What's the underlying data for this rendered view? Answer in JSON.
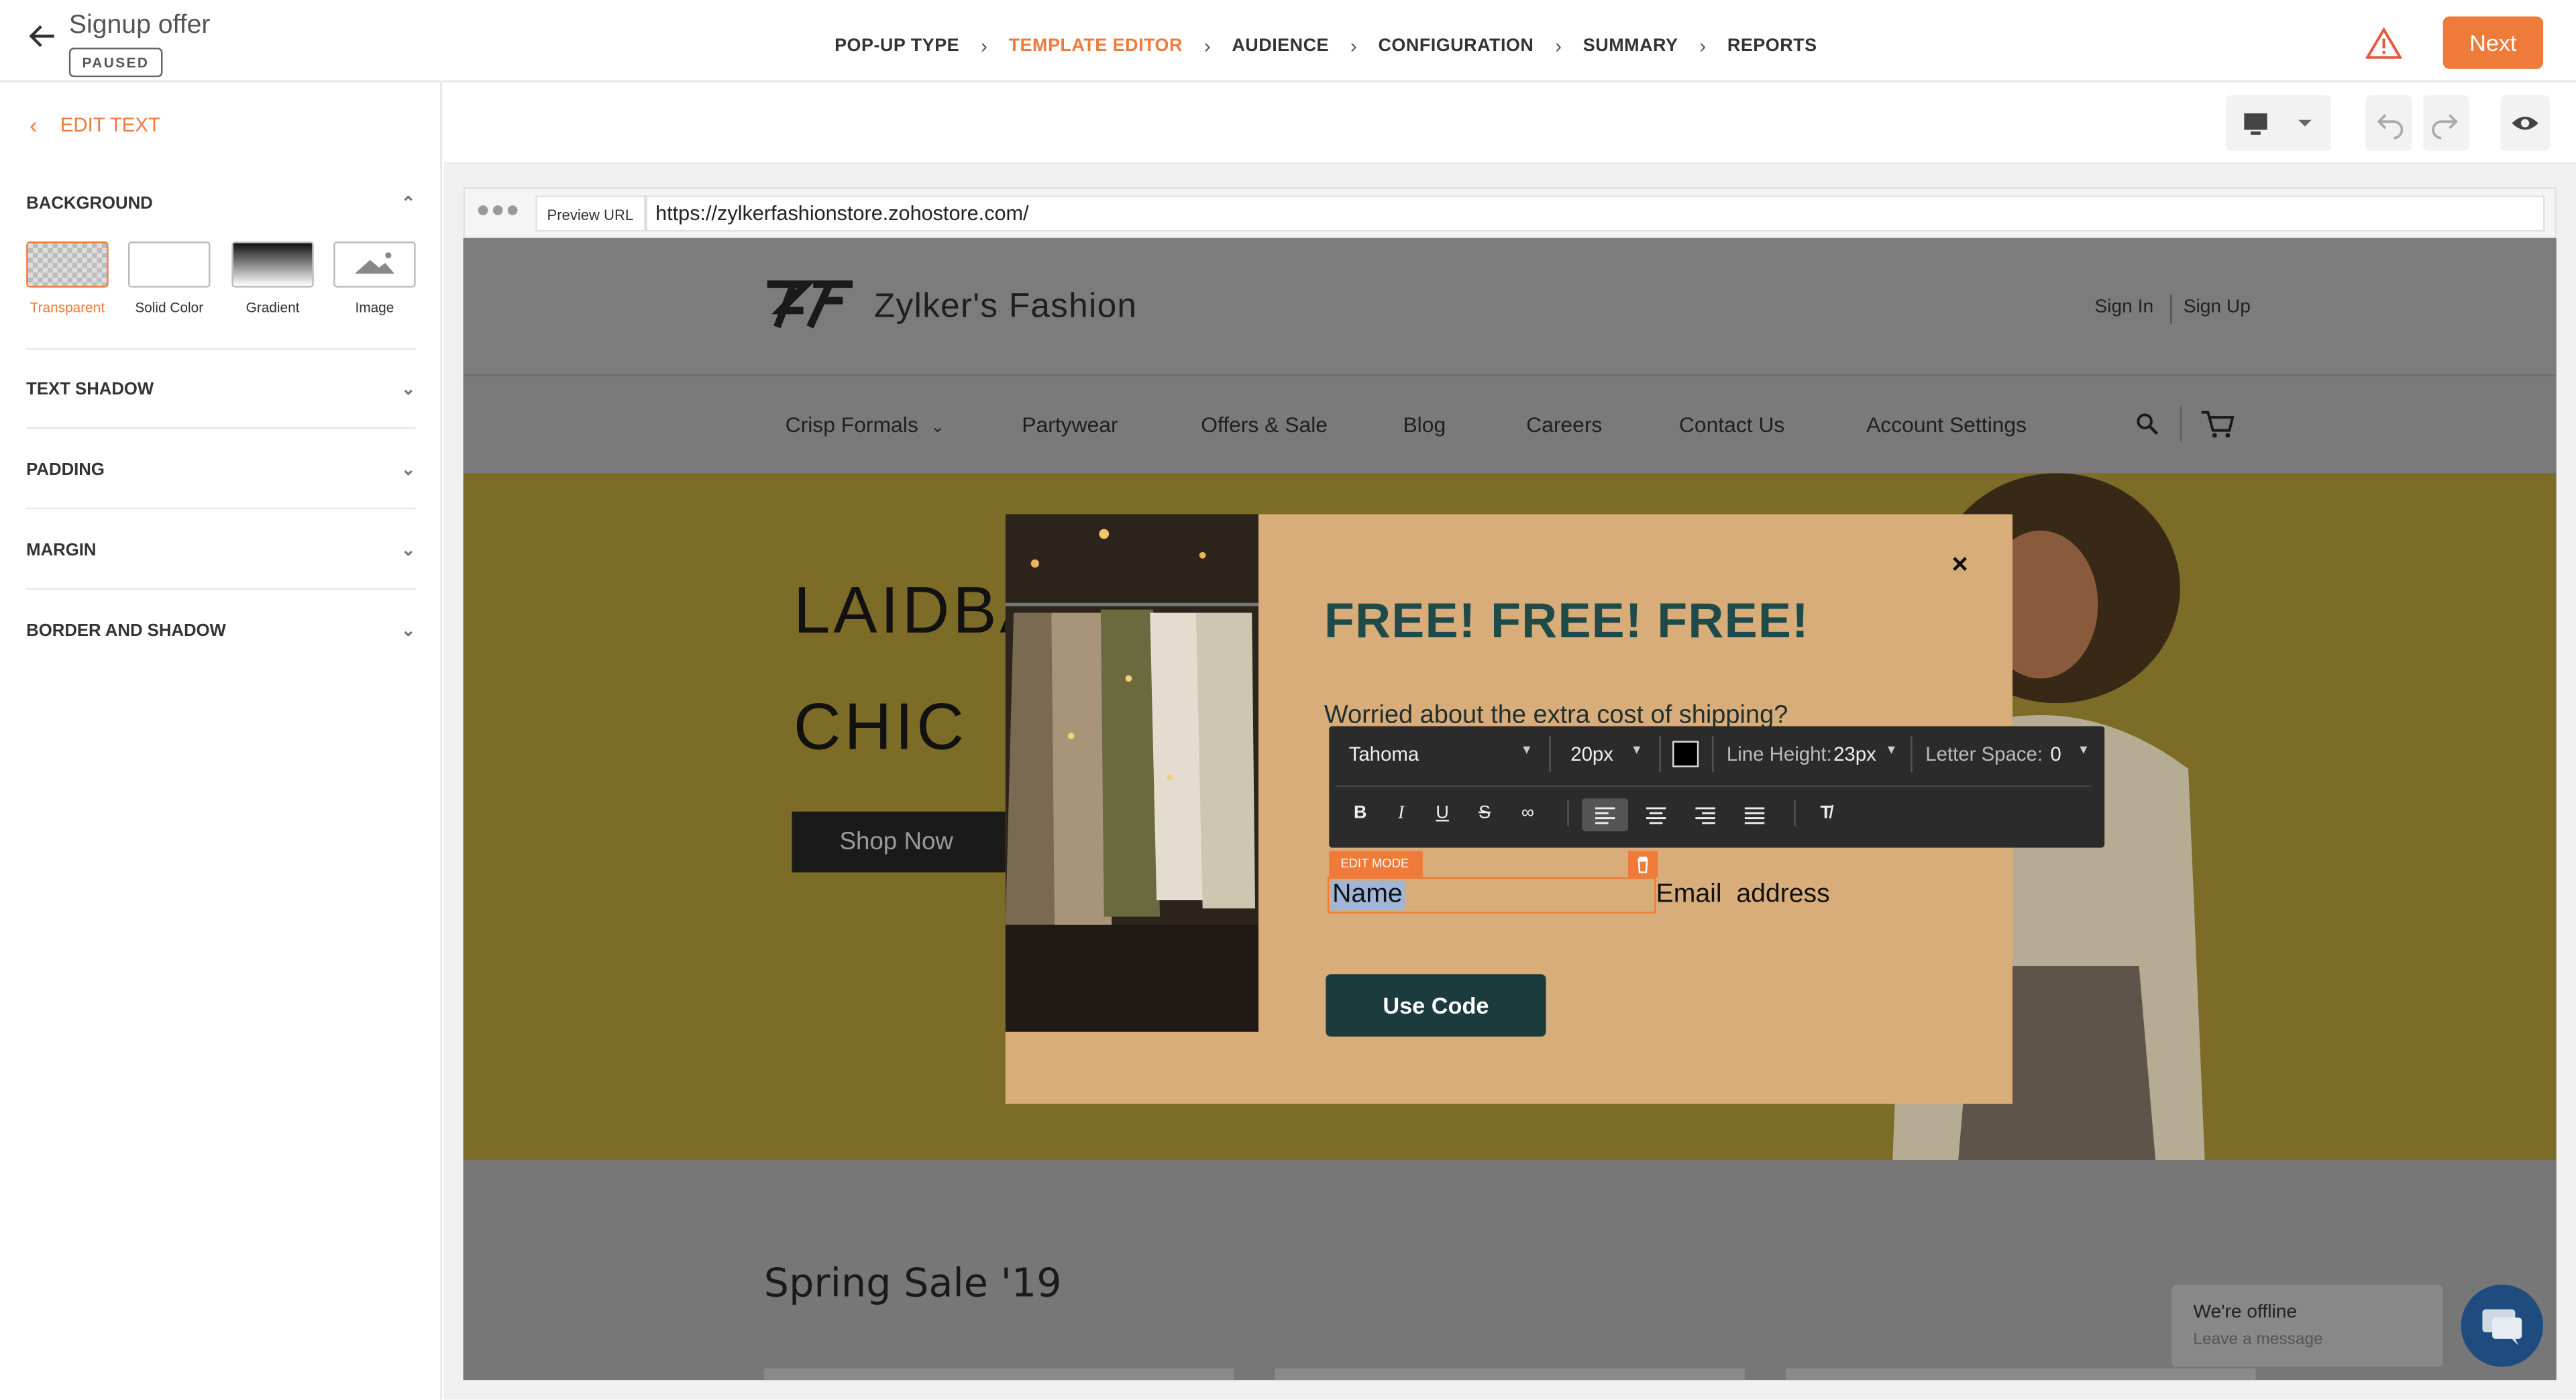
{
  "header": {
    "title": "Signup offer",
    "status_badge": "PAUSED",
    "steps": [
      "POP-UP TYPE",
      "TEMPLATE EDITOR",
      "AUDIENCE",
      "CONFIGURATION",
      "SUMMARY",
      "REPORTS"
    ],
    "active_step": "TEMPLATE EDITOR",
    "next_label": "Next"
  },
  "left_panel": {
    "back_label": "EDIT TEXT",
    "sections": {
      "background": "BACKGROUND",
      "text_shadow": "TEXT SHADOW",
      "padding": "PADDING",
      "margin": "MARGIN",
      "border_shadow": "BORDER AND SHADOW"
    },
    "background_options": [
      "Transparent",
      "Solid Color",
      "Gradient",
      "Image"
    ],
    "selected_background": "Transparent"
  },
  "browser": {
    "preview_label": "Preview URL",
    "url": "https://zylkerfashionstore.zohostore.com/"
  },
  "site": {
    "brand": "Zylker's Fashion",
    "sign_in": "Sign In",
    "sign_up": "Sign Up",
    "nav": [
      "Crisp Formals",
      "Partywear",
      "Offers & Sale",
      "Blog",
      "Careers",
      "Contact Us",
      "Account Settings"
    ],
    "hero_line1": "LAIDBA",
    "hero_line2": "CHIC",
    "hero_button": "Shop Now",
    "section_title": "Spring Sale '19",
    "chat_title": "We're offline",
    "chat_sub": "Leave a message"
  },
  "popup": {
    "headline": "FREE! FREE! FREE!",
    "subtext": "Worried about the extra cost of shipping?",
    "edit_mode_label": "EDIT MODE",
    "name_field": "Name",
    "email_field": "Email  address",
    "button": "Use Code",
    "close_glyph": "×"
  },
  "text_toolbar": {
    "font": "Tahoma",
    "size": "20px",
    "line_height_label": "Line Height:",
    "line_height": "23px",
    "letter_space_label": "Letter Space:",
    "letter_space": "0",
    "text_color": "#000000"
  },
  "colors": {
    "accent": "#ef7b3a",
    "popup_bg": "#d8ad79",
    "headline": "#1f4a4a",
    "button_bg": "#1c3b3d"
  }
}
